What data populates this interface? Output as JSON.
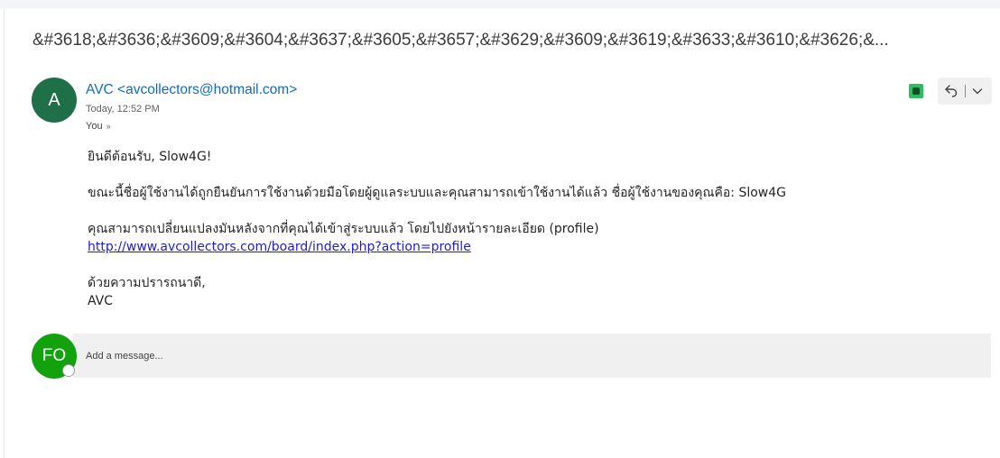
{
  "subject": "&#3618;&#3636;&#3609;&#3604;&#3637;&#3605;&#3657;&#3629;&#3609;&#3619;&#3633;&#3610;&#3626;&...",
  "message": {
    "sender_initial": "A",
    "sender_display": "AVC <avcollectors@hotmail.com>",
    "timestamp": "Today, 12:52 PM",
    "to_label": "You",
    "to_chevron": "»",
    "body": {
      "greeting": "ยินดีต้อนรับ, Slow4G!",
      "paragraph1": "ขณะนี้ชื่อผู้ใช้งานได้ถูกยืนยันการใช้งานด้วยมือโดยผู้ดูแลระบบและคุณสามารถเข้าใช้งานได้แล้ว ชื่อผู้ใช้งานของคุณคือ: Slow4G",
      "paragraph2": "คุณสามารถเปลี่ยนแปลงมันหลังจากที่คุณได้เข้าสู่ระบบแล้ว โดยไปยังหน้ารายละเอียด (profile)",
      "link": "http://www.avcollectors.com/board/index.php?action=profile",
      "closing": "ด้วยความปรารถนาดี,",
      "signature": "AVC"
    }
  },
  "reply": {
    "avatar_initials": "FO",
    "placeholder": "Add a message..."
  },
  "icons": {
    "extension": "evernote-icon",
    "reply_all": "reply-all-icon",
    "more": "chevron-down-icon"
  },
  "colors": {
    "sender_link": "#0f6cbd",
    "sender_avatar": "#1f6f48",
    "me_avatar": "#13a10e",
    "extension": "#2dbe60",
    "hyperlink": "#1d1dcf"
  }
}
